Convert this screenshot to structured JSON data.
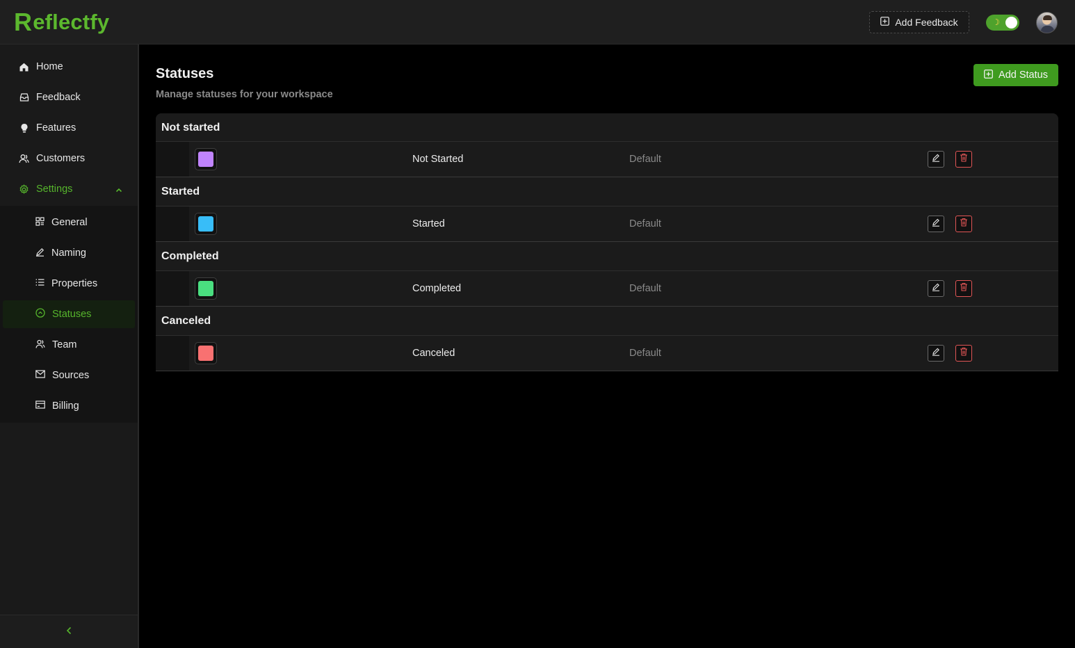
{
  "app": {
    "name_initial": "R",
    "name_rest": "eflectfy"
  },
  "header": {
    "add_feedback_label": "Add Feedback",
    "theme_toggle_icon": "moon-icon"
  },
  "sidebar": {
    "items": [
      {
        "label": "Home",
        "icon": "home-icon"
      },
      {
        "label": "Feedback",
        "icon": "inbox-icon"
      },
      {
        "label": "Features",
        "icon": "lightbulb-icon"
      },
      {
        "label": "Customers",
        "icon": "users-icon"
      },
      {
        "label": "Settings",
        "icon": "gear-icon",
        "expanded": true
      }
    ],
    "settings_items": [
      {
        "label": "General",
        "icon": "grid-icon"
      },
      {
        "label": "Naming",
        "icon": "pencil-icon"
      },
      {
        "label": "Properties",
        "icon": "list-icon"
      },
      {
        "label": "Statuses",
        "icon": "circle-chevron-icon",
        "active": true
      },
      {
        "label": "Team",
        "icon": "team-icon"
      },
      {
        "label": "Sources",
        "icon": "mail-icon"
      },
      {
        "label": "Billing",
        "icon": "card-icon"
      }
    ],
    "collapse_icon": "chevron-left-icon"
  },
  "main": {
    "title": "Statuses",
    "subtitle": "Manage statuses for your workspace",
    "add_status_label": "Add Status",
    "groups": [
      {
        "heading": "Not started",
        "status": {
          "name": "Not Started",
          "tag": "Default",
          "color": "#c084fc"
        }
      },
      {
        "heading": "Started",
        "status": {
          "name": "Started",
          "tag": "Default",
          "color": "#38bdf8"
        }
      },
      {
        "heading": "Completed",
        "status": {
          "name": "Completed",
          "tag": "Default",
          "color": "#4ade80"
        }
      },
      {
        "heading": "Canceled",
        "status": {
          "name": "Canceled",
          "tag": "Default",
          "color": "#f87171"
        }
      }
    ]
  },
  "colors": {
    "accent": "#56b52c",
    "button_green": "#3f9b1f",
    "danger": "#e35656"
  }
}
